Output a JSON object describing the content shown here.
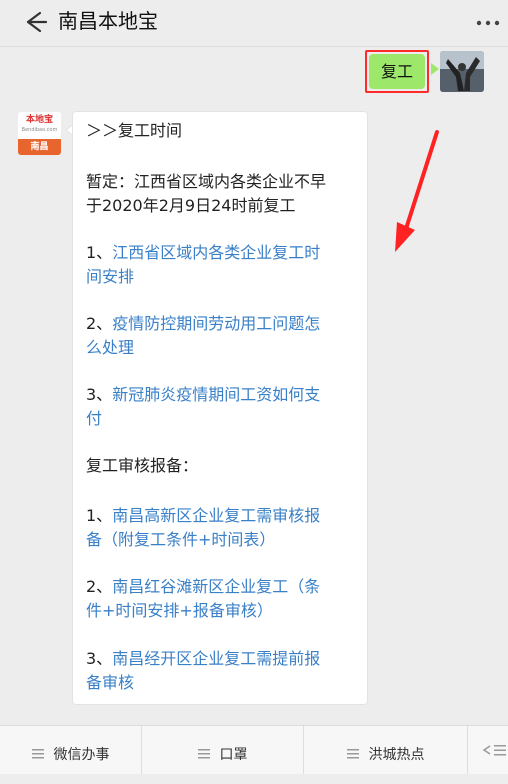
{
  "header": {
    "title": "南昌本地宝",
    "back_icon": "back-arrow-icon",
    "more_icon": "more-icon"
  },
  "sent_message": {
    "text": "复工"
  },
  "received_message": {
    "logo": {
      "top_text": "本地宝",
      "sub_text": "Bendibao.com",
      "city_text": "南昌"
    },
    "lines": [
      {
        "text": "＞＞复工时间",
        "kind": "text"
      },
      {
        "text": "暂定：江西省区域内各类企业不早",
        "kind": "text"
      },
      {
        "text": "于2020年2月9日24时前复工",
        "kind": "text"
      },
      {
        "text": "1、",
        "kind": "text"
      },
      {
        "text": "江西省区域内各类企业复工时",
        "kind": "link"
      },
      {
        "text": "间安排",
        "kind": "link"
      },
      {
        "text": "2、",
        "kind": "text"
      },
      {
        "text": "疫情防控期间劳动用工问题怎",
        "kind": "link"
      },
      {
        "text": "么处理",
        "kind": "link"
      },
      {
        "text": "3、",
        "kind": "text"
      },
      {
        "text": "新冠肺炎疫情期间工资如何支",
        "kind": "link"
      },
      {
        "text": "付",
        "kind": "link"
      },
      {
        "text": "复工审核报备：",
        "kind": "text"
      },
      {
        "text": "1、",
        "kind": "text"
      },
      {
        "text": "南昌高新区企业复工需审核报",
        "kind": "link"
      },
      {
        "text": "备（附复工条件+时间表）",
        "kind": "link"
      },
      {
        "text": "2、",
        "kind": "text"
      },
      {
        "text": "南昌红谷滩新区企业复工（条",
        "kind": "link"
      },
      {
        "text": "件+时间安排+报备审核）",
        "kind": "link"
      },
      {
        "text": "3、",
        "kind": "text"
      },
      {
        "text": "南昌经开区企业复工需提前报",
        "kind": "link"
      },
      {
        "text": "备审核",
        "kind": "link"
      }
    ]
  },
  "bottom_menu": {
    "items": [
      {
        "label": "微信办事"
      },
      {
        "label": "口罩"
      },
      {
        "label": "洪城热点"
      }
    ],
    "keyboard_icon": "keyboard-toggle-icon"
  },
  "colors": {
    "link": "#3a80c8",
    "sent_bubble": "#9de86b",
    "highlight": "#ff2a2a",
    "logo_orange": "#e8652d"
  }
}
